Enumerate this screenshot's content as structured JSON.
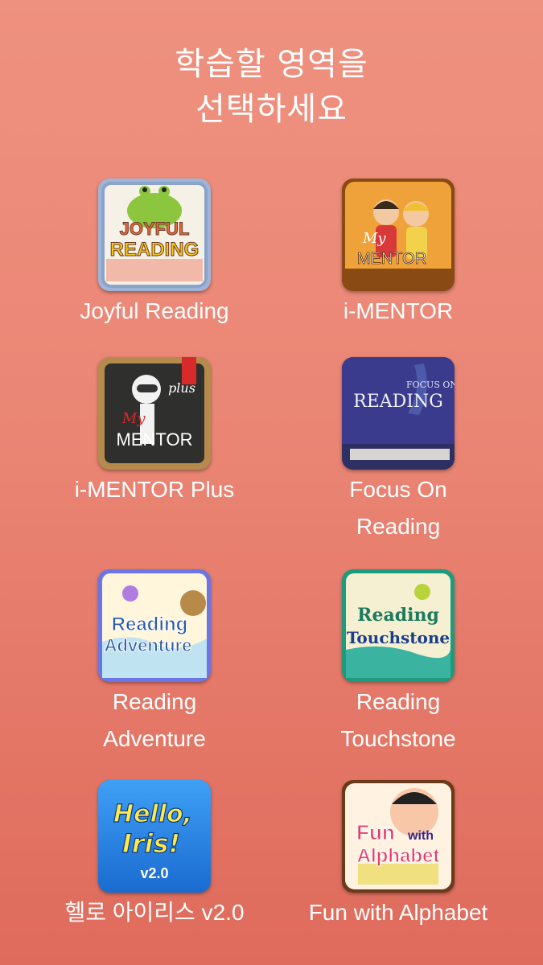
{
  "header": {
    "line1": "학습할 영역을",
    "line2": "선택하세요"
  },
  "apps": [
    {
      "label_lines": [
        "Joyful Reading"
      ],
      "icon_text": [
        "JOYFUL",
        "READING"
      ]
    },
    {
      "label_lines": [
        "i-MENTOR"
      ],
      "icon_text": [
        "My",
        "MENTOR"
      ]
    },
    {
      "label_lines": [
        "i-MENTOR Plus"
      ],
      "icon_text": [
        "My",
        "MENTOR",
        "plus"
      ]
    },
    {
      "label_lines": [
        "Focus On",
        "Reading"
      ],
      "icon_text": [
        "FOCUS ON",
        "READING"
      ]
    },
    {
      "label_lines": [
        "Reading",
        "Adventure"
      ],
      "icon_text": [
        "Reading",
        "Adventure"
      ]
    },
    {
      "label_lines": [
        "Reading",
        "Touchstone"
      ],
      "icon_text": [
        "Reading",
        "Touchstone"
      ]
    },
    {
      "label_lines": [
        "헬로 아이리스 v2.0"
      ],
      "icon_text": [
        "Hello,",
        "Iris!",
        "v2.0"
      ]
    },
    {
      "label_lines": [
        "Fun with Alphabet"
      ],
      "icon_text": [
        "Fun",
        "with",
        "Alphabet"
      ]
    }
  ],
  "colors": {
    "background_top": "#ef917f",
    "background_bottom": "#df6b5c",
    "text": "#ffffff"
  }
}
